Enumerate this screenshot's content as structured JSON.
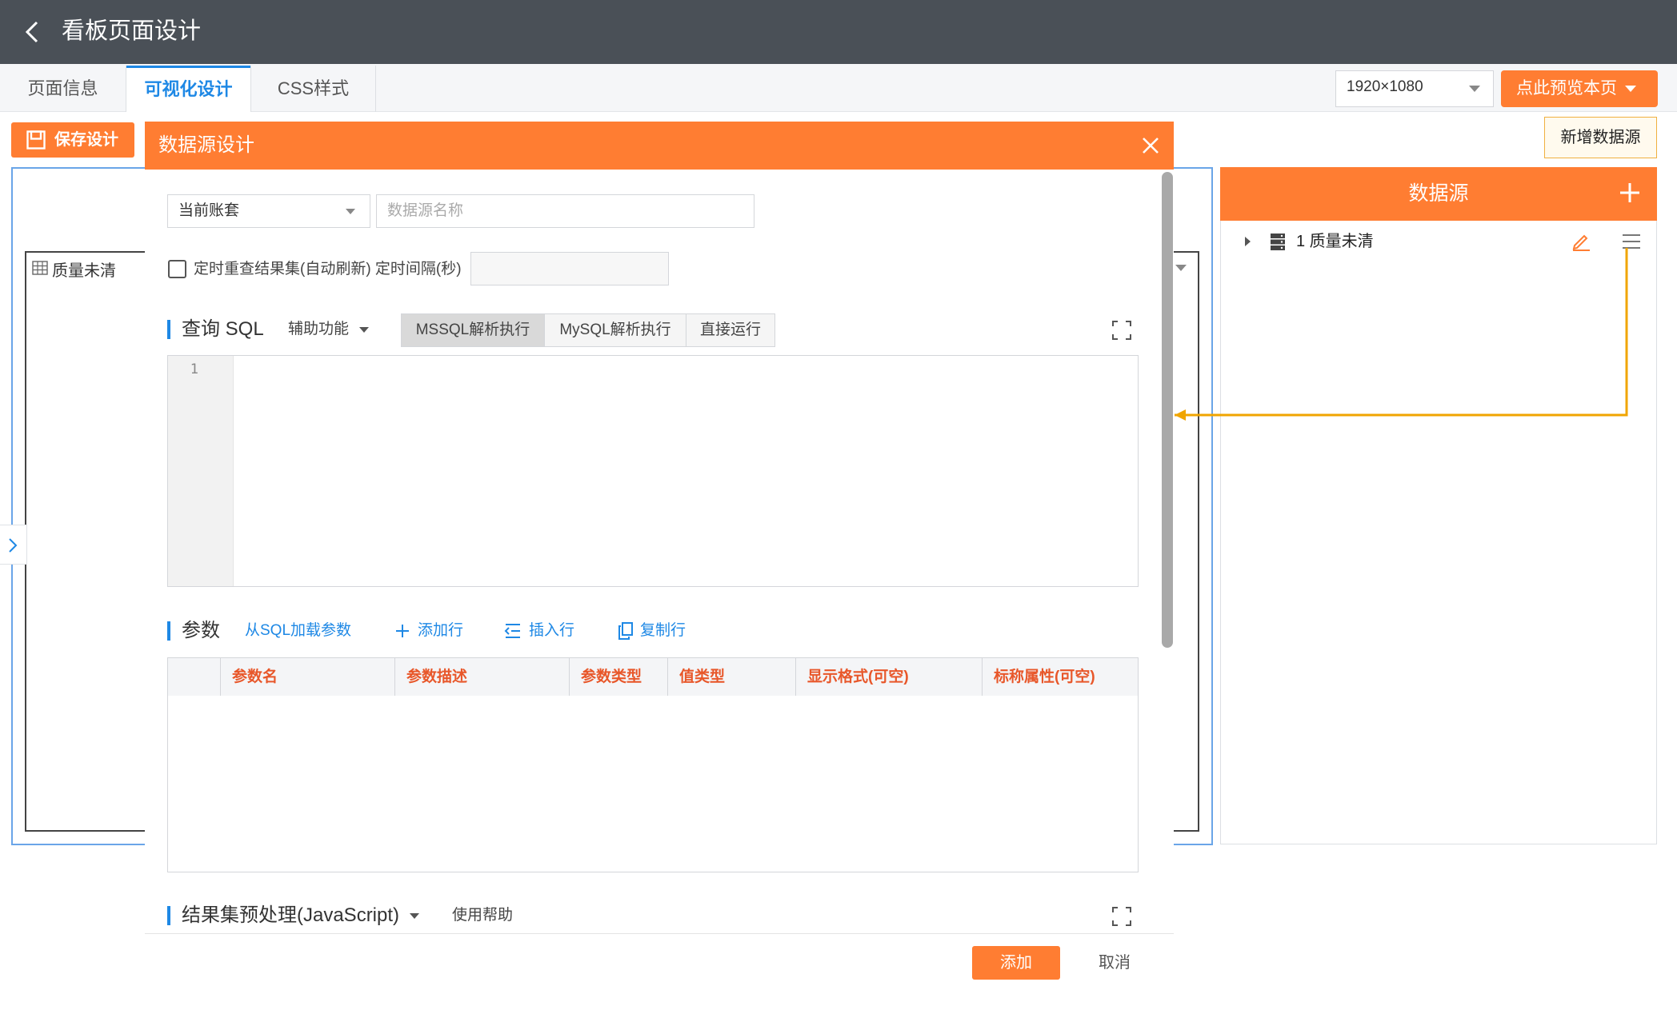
{
  "header": {
    "title": "看板页面设计"
  },
  "tabs": [
    {
      "label": "页面信息"
    },
    {
      "label": "可视化设计"
    },
    {
      "label": "CSS样式"
    }
  ],
  "resolution": {
    "value": "1920×1080"
  },
  "preview_button": {
    "label": "点此预览本页"
  },
  "canvas": {
    "save_label": "保存设计",
    "panel_label": "质量未清"
  },
  "datasource_panel": {
    "add_tip": "新增数据源",
    "title": "数据源",
    "items": [
      {
        "label": "1 质量未清"
      }
    ]
  },
  "dialog": {
    "title": "数据源设计",
    "account_select": "当前账套",
    "name_placeholder": "数据源名称",
    "auto_refresh_label": "定时重查结果集(自动刷新) 定时间隔(秒)",
    "sql_section": {
      "title": "查询 SQL",
      "assist_label": "辅助功能",
      "modes": [
        "MSSQL解析执行",
        "MySQL解析执行",
        "直接运行"
      ],
      "line_numbers": [
        "1"
      ]
    },
    "params_section": {
      "title": "参数",
      "actions": [
        "从SQL加载参数",
        "添加行",
        "插入行",
        "复制行"
      ],
      "columns": [
        "参数名",
        "参数描述",
        "参数类型",
        "值类型",
        "显示格式(可空)",
        "标称属性(可空)"
      ]
    },
    "result_section": {
      "title": "结果集预处理(JavaScript)",
      "help_label": "使用帮助"
    },
    "buttons": {
      "add": "添加",
      "cancel": "取消"
    }
  },
  "colors": {
    "accent": "#ff7d32",
    "primary": "#1e88e5",
    "header_bg": "#4a5057",
    "column_header": "#e8572a"
  }
}
